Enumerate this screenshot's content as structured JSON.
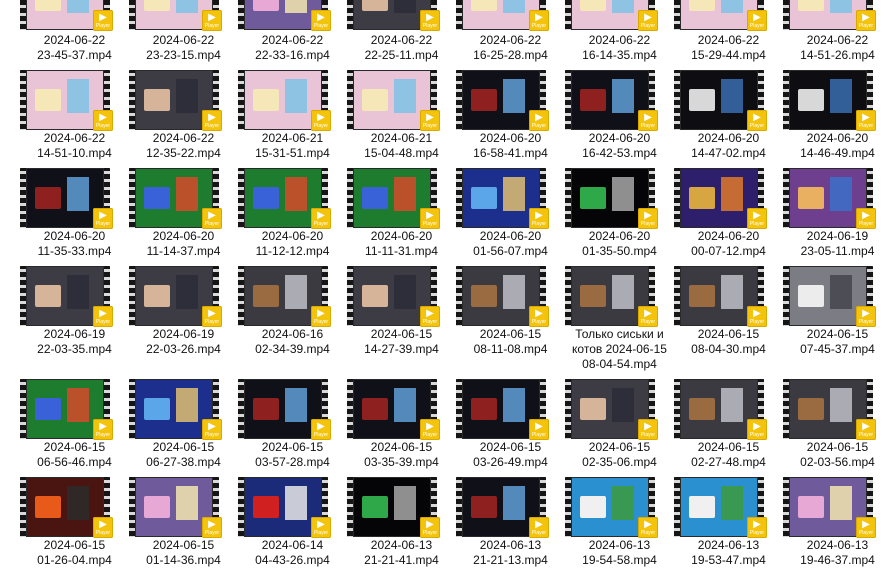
{
  "window": {
    "view": "Large icons"
  },
  "badge_label": "Player",
  "files": [
    {
      "line1": "2024-06-22",
      "line2": "23-45-37.mp4",
      "theme": "pink"
    },
    {
      "line1": "2024-06-22",
      "line2": "23-23-15.mp4",
      "theme": "pink"
    },
    {
      "line1": "2024-06-22",
      "line2": "22-33-16.mp4",
      "theme": "purple"
    },
    {
      "line1": "2024-06-22",
      "line2": "22-25-11.mp4",
      "theme": "person"
    },
    {
      "line1": "2024-06-22",
      "line2": "16-25-28.mp4",
      "theme": "pink"
    },
    {
      "line1": "2024-06-22",
      "line2": "16-14-35.mp4",
      "theme": "pink"
    },
    {
      "line1": "2024-06-22",
      "line2": "15-29-44.mp4",
      "theme": "pink"
    },
    {
      "line1": "2024-06-22",
      "line2": "14-51-26.mp4",
      "theme": "pink"
    },
    {
      "line1": "2024-06-22",
      "line2": "14-51-10.mp4",
      "theme": "pink"
    },
    {
      "line1": "2024-06-22",
      "line2": "12-35-22.mp4",
      "theme": "person"
    },
    {
      "line1": "2024-06-21",
      "line2": "15-31-51.mp4",
      "theme": "pink"
    },
    {
      "line1": "2024-06-21",
      "line2": "15-04-48.mp4",
      "theme": "pink"
    },
    {
      "line1": "2024-06-20",
      "line2": "16-58-41.mp4",
      "theme": "dark"
    },
    {
      "line1": "2024-06-20",
      "line2": "16-42-53.mp4",
      "theme": "dark"
    },
    {
      "line1": "2024-06-20",
      "line2": "14-47-02.mp4",
      "theme": "text"
    },
    {
      "line1": "2024-06-20",
      "line2": "14-46-49.mp4",
      "theme": "text"
    },
    {
      "line1": "2024-06-20",
      "line2": "11-35-33.mp4",
      "theme": "dark"
    },
    {
      "line1": "2024-06-20",
      "line2": "11-14-37.mp4",
      "theme": "green"
    },
    {
      "line1": "2024-06-20",
      "line2": "11-12-12.mp4",
      "theme": "green"
    },
    {
      "line1": "2024-06-20",
      "line2": "11-11-31.mp4",
      "theme": "green"
    },
    {
      "line1": "2024-06-20",
      "line2": "01-56-07.mp4",
      "theme": "blue"
    },
    {
      "line1": "2024-06-20",
      "line2": "01-35-50.mp4",
      "theme": "space"
    },
    {
      "line1": "2024-06-20",
      "line2": "00-07-12.mp4",
      "theme": "gold"
    },
    {
      "line1": "2024-06-19",
      "line2": "23-05-11.mp4",
      "theme": "desert"
    },
    {
      "line1": "2024-06-19",
      "line2": "22-03-35.mp4",
      "theme": "person"
    },
    {
      "line1": "2024-06-19",
      "line2": "22-03-26.mp4",
      "theme": "person"
    },
    {
      "line1": "2024-06-16",
      "line2": "02-34-39.mp4",
      "theme": "fight"
    },
    {
      "line1": "2024-06-15",
      "line2": "14-27-39.mp4",
      "theme": "person"
    },
    {
      "line1": "2024-06-15",
      "line2": "08-11-08.mp4",
      "theme": "fight"
    },
    {
      "line1": "Только сиськи и",
      "line2": "котов 2024-06-15",
      "line3": "08-04-54.mp4",
      "theme": "fight"
    },
    {
      "line1": "2024-06-15",
      "line2": "08-04-30.mp4",
      "theme": "fight"
    },
    {
      "line1": "2024-06-15",
      "line2": "07-45-37.mp4",
      "theme": "gray"
    },
    {
      "line1": "2024-06-15",
      "line2": "06-56-46.mp4",
      "theme": "green"
    },
    {
      "line1": "2024-06-15",
      "line2": "06-27-38.mp4",
      "theme": "blue"
    },
    {
      "line1": "2024-06-15",
      "line2": "03-57-28.mp4",
      "theme": "dark"
    },
    {
      "line1": "2024-06-15",
      "line2": "03-35-39.mp4",
      "theme": "dark"
    },
    {
      "line1": "2024-06-15",
      "line2": "03-26-49.mp4",
      "theme": "dark"
    },
    {
      "line1": "2024-06-15",
      "line2": "02-35-06.mp4",
      "theme": "person"
    },
    {
      "line1": "2024-06-15",
      "line2": "02-27-48.mp4",
      "theme": "fight"
    },
    {
      "line1": "2024-06-15",
      "line2": "02-03-56.mp4",
      "theme": "fight"
    },
    {
      "line1": "2024-06-15",
      "line2": "01-26-04.mp4",
      "theme": "fire"
    },
    {
      "line1": "2024-06-15",
      "line2": "01-14-36.mp4",
      "theme": "purple"
    },
    {
      "line1": "2024-06-14",
      "line2": "04-43-26.mp4",
      "theme": "red"
    },
    {
      "line1": "2024-06-13",
      "line2": "21-21-41.mp4",
      "theme": "space"
    },
    {
      "line1": "2024-06-13",
      "line2": "21-21-13.mp4",
      "theme": "dark"
    },
    {
      "line1": "2024-06-13",
      "line2": "19-54-58.mp4",
      "theme": "sky"
    },
    {
      "line1": "2024-06-13",
      "line2": "19-53-47.mp4",
      "theme": "sky"
    },
    {
      "line1": "2024-06-13",
      "line2": "19-46-37.mp4",
      "theme": "purple"
    }
  ],
  "themes": {
    "pink": {
      "bg": "#e9c4d7",
      "a": "#f6e7b8",
      "b": "#7fc3e6"
    },
    "purple": {
      "bg": "#6f5a9c",
      "a": "#e7a8d6",
      "b": "#f4e6b0"
    },
    "person": {
      "bg": "#3d3b44",
      "a": "#d6b49a",
      "b": "#2c2c38"
    },
    "dark": {
      "bg": "#101018",
      "a": "#8f2020",
      "b": "#5fa0d8"
    },
    "text": {
      "bg": "#0d0d12",
      "a": "#d8d8d8",
      "b": "#3a6fb0"
    },
    "green": {
      "bg": "#1d7c2d",
      "a": "#3a62d8",
      "b": "#d64a2c"
    },
    "blue": {
      "bg": "#1d2f8c",
      "a": "#5aa6e8",
      "b": "#e0c070"
    },
    "space": {
      "bg": "#050508",
      "a": "#2fa84a",
      "b": "#a8a8a8"
    },
    "gold": {
      "bg": "#2d1f6b",
      "a": "#d8a640",
      "b": "#e07a2a"
    },
    "desert": {
      "bg": "#6e3f8f",
      "a": "#e8b060",
      "b": "#3c70c8"
    },
    "fight": {
      "bg": "#3a3a40",
      "a": "#9a6a40",
      "b": "#c0c0c8"
    },
    "gray": {
      "bg": "#7c7c84",
      "a": "#ececec",
      "b": "#45454e"
    },
    "fire": {
      "bg": "#4a1510",
      "a": "#e85a1a",
      "b": "#2c2c2c"
    },
    "red": {
      "bg": "#1b2b7a",
      "a": "#d02020",
      "b": "#e8e8e8"
    },
    "sky": {
      "bg": "#2a90d0",
      "a": "#f0f0f0",
      "b": "#3c9a3c"
    }
  },
  "colors": {
    "badge": "#f4c40d",
    "caption": "#111111"
  }
}
